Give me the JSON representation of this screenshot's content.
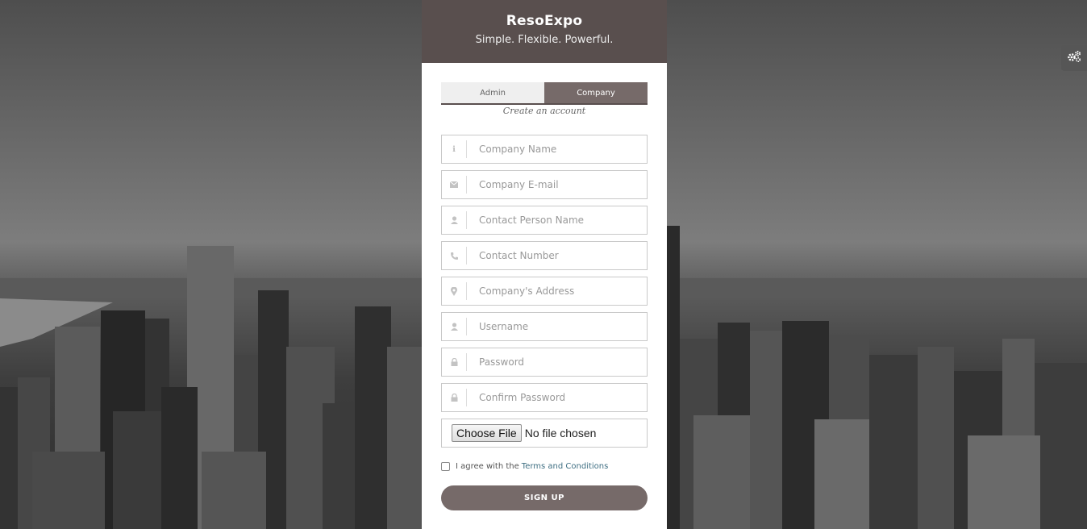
{
  "header": {
    "brand": "ResoExpo",
    "tagline": "Simple. Flexible. Powerful."
  },
  "tabs": [
    {
      "label": "Admin",
      "active": false
    },
    {
      "label": "Company",
      "active": true
    }
  ],
  "subtitle": "Create an account",
  "fields": [
    {
      "icon": "info-icon",
      "placeholder": "Company Name",
      "value": ""
    },
    {
      "icon": "envelope-icon",
      "placeholder": "Company E-mail",
      "value": ""
    },
    {
      "icon": "user-icon",
      "placeholder": "Contact Person Name",
      "value": ""
    },
    {
      "icon": "phone-icon",
      "placeholder": "Contact Number",
      "value": ""
    },
    {
      "icon": "map-marker-icon",
      "placeholder": "Company's Address",
      "value": ""
    },
    {
      "icon": "user-icon",
      "placeholder": "Username",
      "value": ""
    },
    {
      "icon": "lock-icon",
      "placeholder": "Password",
      "value": ""
    },
    {
      "icon": "lock-icon",
      "placeholder": "Confirm Password",
      "value": ""
    }
  ],
  "file_upload": {
    "button_label": "Choose File",
    "status": "No file chosen"
  },
  "agreement": {
    "checked": false,
    "text": "I agree with the",
    "link": "Terms and Conditions"
  },
  "submit_label": "SIGN UP",
  "settings_icon": "gears-icon",
  "colors": {
    "header_bg": "#594f4e",
    "accent": "#766a69",
    "link": "#3f6f83"
  }
}
